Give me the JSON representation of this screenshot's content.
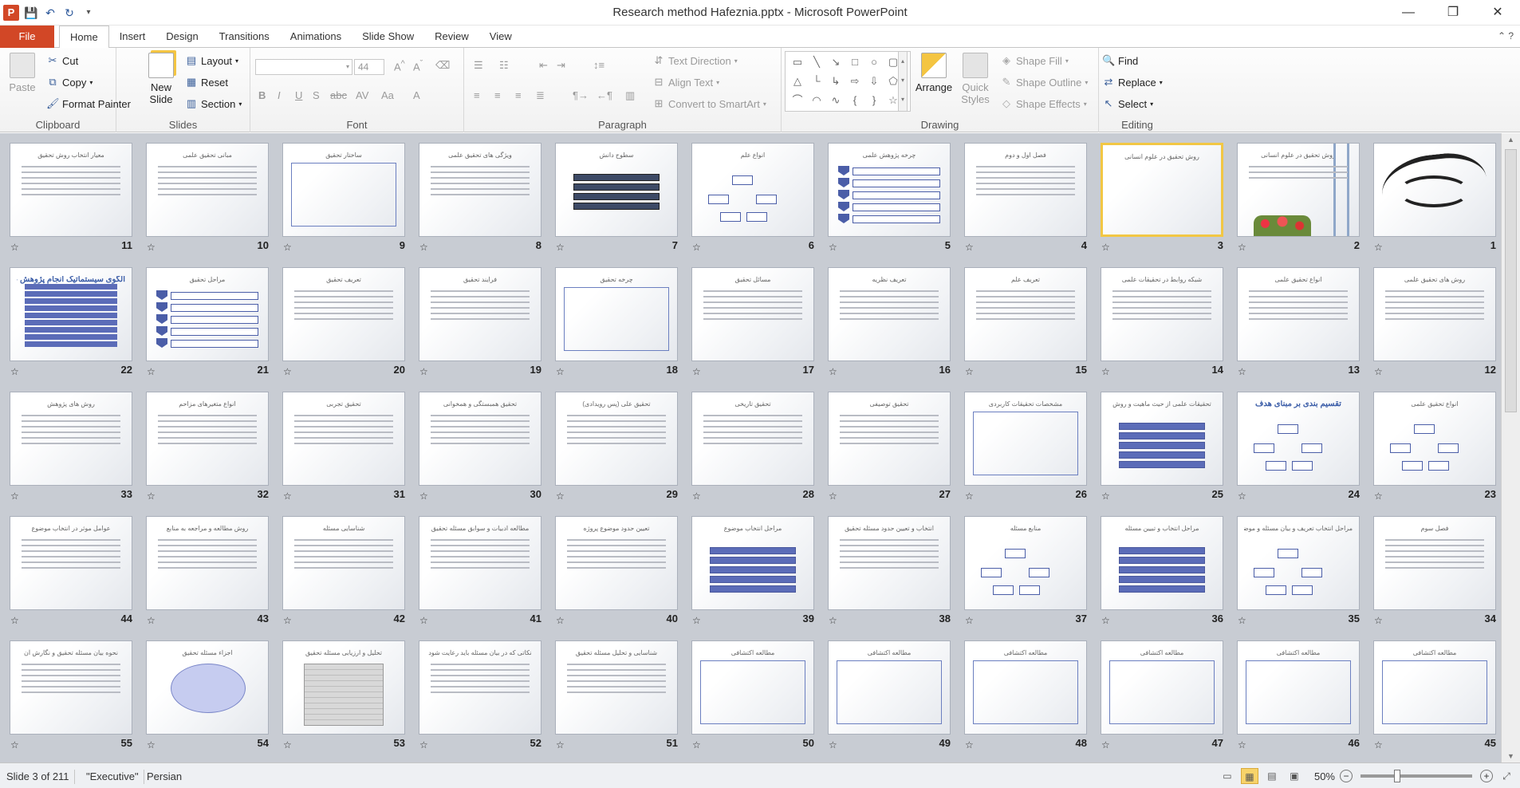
{
  "app": {
    "title": "Research method Hafeznia.pptx  -  Microsoft PowerPoint",
    "logo_letter": "P"
  },
  "window_controls": {
    "minimize": "—",
    "maximize": "❐",
    "close": "✕"
  },
  "menu": {
    "file": "File",
    "tabs": [
      "Home",
      "Insert",
      "Design",
      "Transitions",
      "Animations",
      "Slide Show",
      "Review",
      "View"
    ],
    "active_tab": "Home"
  },
  "ribbon": {
    "clipboard": {
      "label": "Clipboard",
      "paste": "Paste",
      "cut": "Cut",
      "copy": "Copy",
      "format_painter": "Format Painter"
    },
    "slides": {
      "label": "Slides",
      "new_slide": "New Slide",
      "layout": "Layout",
      "reset": "Reset",
      "section": "Section"
    },
    "font": {
      "label": "Font",
      "size": "44"
    },
    "paragraph": {
      "label": "Paragraph",
      "text_direction": "Text Direction",
      "align_text": "Align Text",
      "convert_smartart": "Convert to SmartArt"
    },
    "drawing": {
      "label": "Drawing",
      "arrange": "Arrange",
      "quick_styles": "Quick Styles",
      "shape_fill": "Shape Fill",
      "shape_outline": "Shape Outline",
      "shape_effects": "Shape Effects"
    },
    "editing": {
      "label": "Editing",
      "find": "Find",
      "replace": "Replace",
      "select": "Select"
    }
  },
  "slides": [
    {
      "n": "11",
      "title": "معیار انتخاب روش تحقیق"
    },
    {
      "n": "10",
      "title": "مبانی تحقیق علمی"
    },
    {
      "n": "9",
      "title": "ساختار تحقیق"
    },
    {
      "n": "8",
      "title": "ویژگی های تحقیق علمی"
    },
    {
      "n": "7",
      "title": "سطوح دانش"
    },
    {
      "n": "6",
      "title": "انواع علم"
    },
    {
      "n": "5",
      "title": "چرخه پژوهش علمی"
    },
    {
      "n": "4",
      "title": "فصل اول و دوم"
    },
    {
      "n": "3",
      "title": "روش تحقیق در علوم انسانی"
    },
    {
      "n": "2",
      "title": "روش تحقیق در علوم انسانی"
    },
    {
      "n": "1",
      "title": ""
    },
    {
      "n": "22",
      "title": "الگوی سیستماتیک انجام پژوهش علمی"
    },
    {
      "n": "21",
      "title": "مراحل تحقیق"
    },
    {
      "n": "20",
      "title": "تعریف تحقیق"
    },
    {
      "n": "19",
      "title": "فرایند تحقیق"
    },
    {
      "n": "18",
      "title": "چرخه تحقیق"
    },
    {
      "n": "17",
      "title": "مسائل تحقیق"
    },
    {
      "n": "16",
      "title": "تعریف نظریه"
    },
    {
      "n": "15",
      "title": "تعریف علم"
    },
    {
      "n": "14",
      "title": "شبکه روابط در تحقیقات علمی"
    },
    {
      "n": "13",
      "title": "انواع تحقیق علمی"
    },
    {
      "n": "12",
      "title": "روش های تحقیق علمی"
    },
    {
      "n": "33",
      "title": "روش های پژوهش"
    },
    {
      "n": "32",
      "title": "انواع متغیرهای مزاحم"
    },
    {
      "n": "31",
      "title": "تحقیق تجربی"
    },
    {
      "n": "30",
      "title": "تحقیق همبستگی و همخوانی"
    },
    {
      "n": "29",
      "title": "تحقیق علی (پس رویدادی)"
    },
    {
      "n": "28",
      "title": "تحقیق تاریخی"
    },
    {
      "n": "27",
      "title": "تحقیق توصیفی"
    },
    {
      "n": "26",
      "title": "مشخصات تحقیقات کاربردی"
    },
    {
      "n": "25",
      "title": "تحقیقات علمی از حیث ماهیت و روش"
    },
    {
      "n": "24",
      "title": "تقسیم بندی بر مبنای هدف"
    },
    {
      "n": "23",
      "title": "انواع تحقیق علمی"
    },
    {
      "n": "44",
      "title": "عوامل موثر در انتخاب موضوع"
    },
    {
      "n": "43",
      "title": "روش مطالعه و مراجعه به منابع"
    },
    {
      "n": "42",
      "title": "شناسایی مسئله"
    },
    {
      "n": "41",
      "title": "مطالعه ادبیات و سوابق مسئله تحقیق"
    },
    {
      "n": "40",
      "title": "تعیین حدود موضوع پروژه"
    },
    {
      "n": "39",
      "title": "مراحل انتخاب موضوع"
    },
    {
      "n": "38",
      "title": "انتخاب و تعیین حدود مسئله تحقیق"
    },
    {
      "n": "37",
      "title": "منابع مسئله"
    },
    {
      "n": "36",
      "title": "مراحل انتخاب و تبیین مسئله"
    },
    {
      "n": "35",
      "title": "مراحل انتخاب تعریف و بیان مسئله و موضوع تحقیق"
    },
    {
      "n": "34",
      "title": "فصل سوم"
    },
    {
      "n": "55",
      "title": "نحوه بیان مسئله تحقیق و نگارش آن"
    },
    {
      "n": "54",
      "title": "اجزاء مسئله تحقیق"
    },
    {
      "n": "53",
      "title": "تحلیل و ارزیابی مسئله تحقیق"
    },
    {
      "n": "52",
      "title": "نکاتی که در بیان مسئله باید رعایت شود"
    },
    {
      "n": "51",
      "title": "شناسایی و تحلیل مسئله تحقیق"
    },
    {
      "n": "50",
      "title": "مطالعه اکتشافی"
    },
    {
      "n": "49",
      "title": "مطالعه اکتشافی"
    },
    {
      "n": "48",
      "title": "مطالعه اکتشافی"
    },
    {
      "n": "47",
      "title": "مطالعه اکتشافی"
    },
    {
      "n": "46",
      "title": "مطالعه اکتشافی"
    },
    {
      "n": "45",
      "title": "مطالعه اکتشافی"
    }
  ],
  "status": {
    "slide_info": "Slide 3 of 211",
    "theme": "\"Executive\"",
    "language": "Persian",
    "zoom": "50%"
  }
}
